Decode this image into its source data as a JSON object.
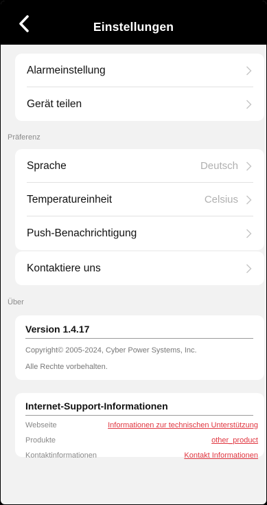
{
  "header": {
    "title": "Einstellungen",
    "back_icon": "chevron-left-icon"
  },
  "group1": [
    {
      "label": "Alarmeinstellung"
    },
    {
      "label": "Gerät teilen"
    }
  ],
  "section_preferences": "Präferenz",
  "group2": [
    {
      "label": "Sprache",
      "value": "Deutsch"
    },
    {
      "label": "Temperatureinheit",
      "value": "Celsius"
    },
    {
      "label": "Push-Benachrichtigung"
    }
  ],
  "group3": [
    {
      "label": "Kontaktiere uns"
    }
  ],
  "section_about": "Über",
  "version": {
    "title": "Version 1.4.17",
    "copyright": "Copyright© 2005-2024, Cyber Power Systems, Inc.",
    "rights": "Alle Rechte vorbehalten."
  },
  "support": {
    "title": "Internet-Support-Informationen",
    "rows": [
      {
        "label": "Webseite",
        "link": "Informationen zur technischen Unterstützung"
      },
      {
        "label": "Produkte",
        "link": "other_product"
      },
      {
        "label": "Kontaktinformationen",
        "link": "Kontakt Informationen"
      }
    ]
  },
  "colors": {
    "header": "#000000",
    "link": "#e0353f",
    "background": "#f2f2f2"
  }
}
